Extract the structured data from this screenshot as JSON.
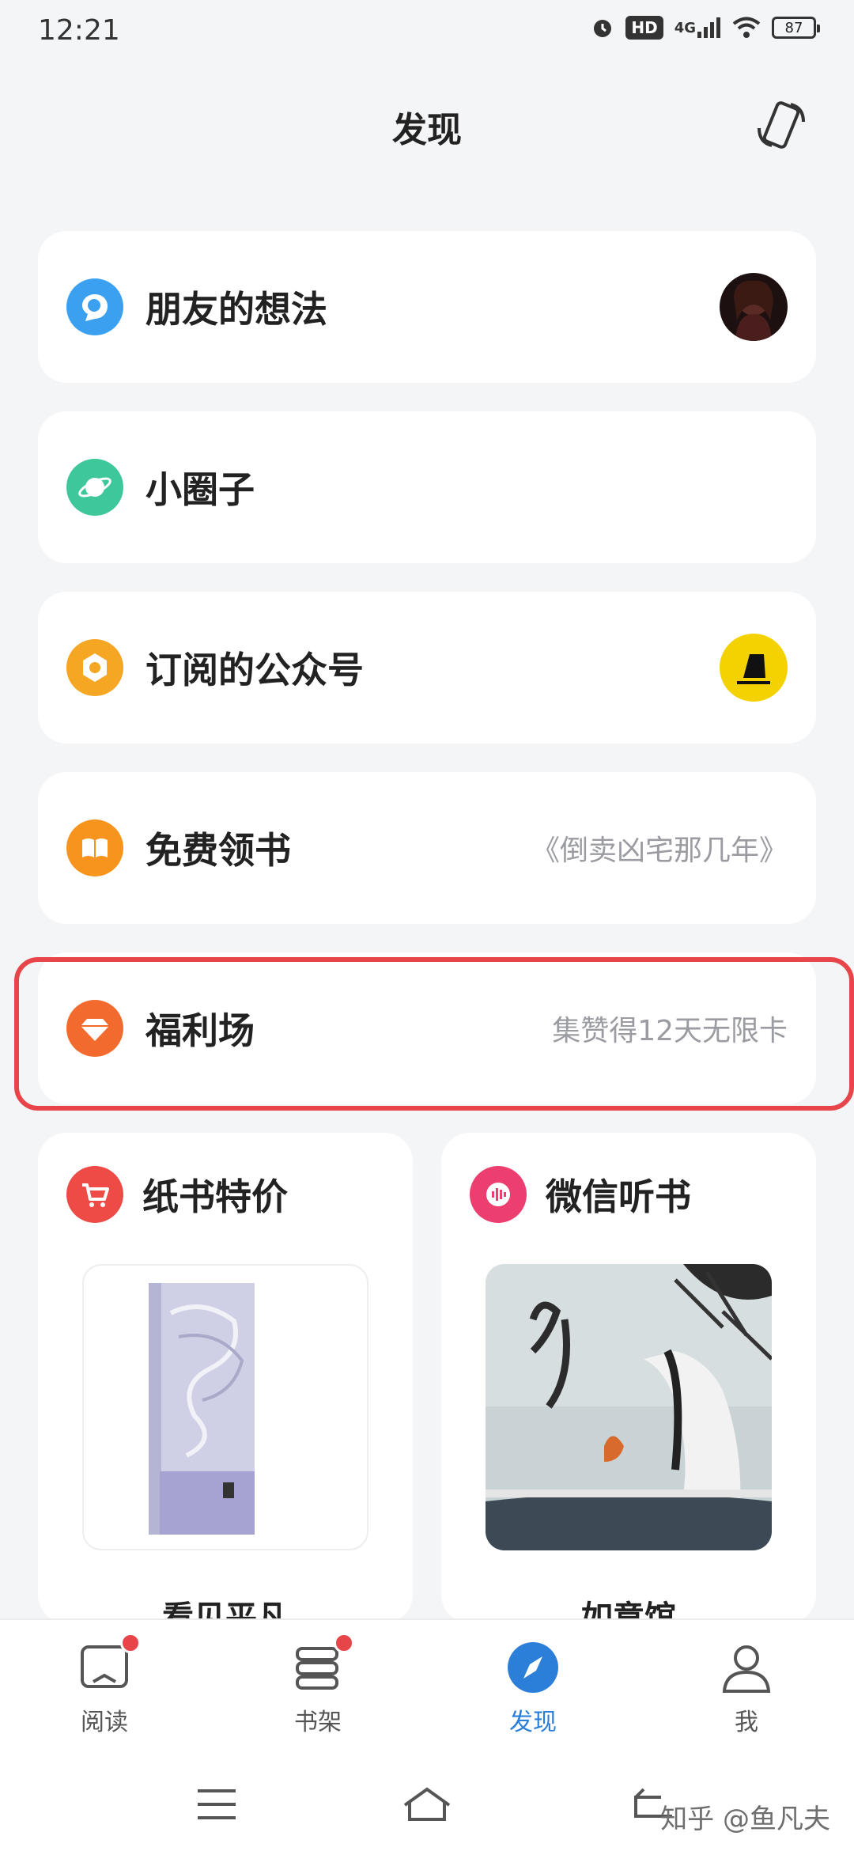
{
  "status_bar": {
    "time": "12:21",
    "network": "4G",
    "hd": "HD",
    "battery": "87"
  },
  "header": {
    "title": "发现",
    "rotate_icon": "rotate-phone-icon"
  },
  "cards": [
    {
      "label": "朋友的想法",
      "icon": "friend-thoughts-icon",
      "icon_color": "#3aa0ef",
      "right_type": "avatar"
    },
    {
      "label": "小圈子",
      "icon": "planet-icon",
      "icon_color": "#3ec79a",
      "right_type": "none"
    },
    {
      "label": "订阅的公众号",
      "icon": "subscription-icon",
      "icon_color": "#f5a623",
      "right_type": "logo"
    },
    {
      "label": "免费领书",
      "icon": "book-open-icon",
      "icon_color": "#f7941d",
      "right_text": "《倒卖凶宅那几年》"
    },
    {
      "label": "福利场",
      "icon": "diamond-icon",
      "icon_color": "#f26a2e",
      "right_text": "集赞得12天无限卡"
    }
  ],
  "tiles": [
    {
      "title": "纸书特价",
      "icon": "cart-icon",
      "icon_color": "#ee4b47",
      "book": "看见平凡"
    },
    {
      "title": "微信听书",
      "icon": "audio-wave-icon",
      "icon_color": "#ec3f6f",
      "book": "如意馆"
    }
  ],
  "tab_bar": {
    "items": [
      {
        "label": "阅读",
        "icon": "read-book-icon",
        "badge": true,
        "active": false
      },
      {
        "label": "书架",
        "icon": "bookshelf-icon",
        "badge": true,
        "active": false
      },
      {
        "label": "发现",
        "icon": "compass-icon",
        "badge": false,
        "active": true
      },
      {
        "label": "我",
        "icon": "user-icon",
        "badge": false,
        "active": false
      }
    ]
  },
  "watermark": "知乎 @鱼凡夫",
  "colors": {
    "accent": "#2b7fd8",
    "highlight": "#e8454a",
    "background": "#f4f5f7"
  }
}
